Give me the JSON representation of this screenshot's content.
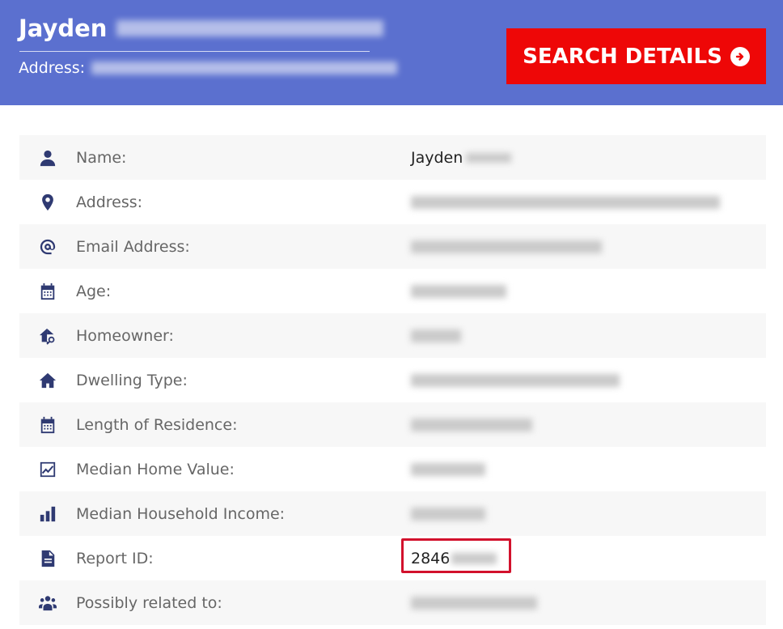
{
  "header": {
    "first_name": "Jayden",
    "address_label": "Address:",
    "search_button_label": "SEARCH DETAILS"
  },
  "rows": [
    {
      "label": "Name:",
      "value": "Jayden",
      "icon": "person-icon"
    },
    {
      "label": "Address:",
      "value": "",
      "icon": "location-pin-icon"
    },
    {
      "label": "Email Address:",
      "value": "",
      "icon": "at-sign-icon"
    },
    {
      "label": "Age:",
      "value": "",
      "icon": "calendar-icon"
    },
    {
      "label": "Homeowner:",
      "value": "",
      "icon": "house-key-icon"
    },
    {
      "label": "Dwelling Type:",
      "value": "",
      "icon": "home-icon"
    },
    {
      "label": "Length of Residence:",
      "value": "",
      "icon": "calendar-icon"
    },
    {
      "label": "Median Home Value:",
      "value": "",
      "icon": "line-chart-icon"
    },
    {
      "label": "Median Household Income:",
      "value": "",
      "icon": "bar-chart-icon"
    },
    {
      "label": "Report ID:",
      "value": "2846",
      "icon": "document-icon"
    },
    {
      "label": "Possibly related to:",
      "value": "",
      "icon": "people-group-icon"
    }
  ],
  "colors": {
    "header_bg": "#5b70cf",
    "button_bg": "#ee0707",
    "icon": "#2f3a72",
    "highlight": "#d2112c"
  }
}
